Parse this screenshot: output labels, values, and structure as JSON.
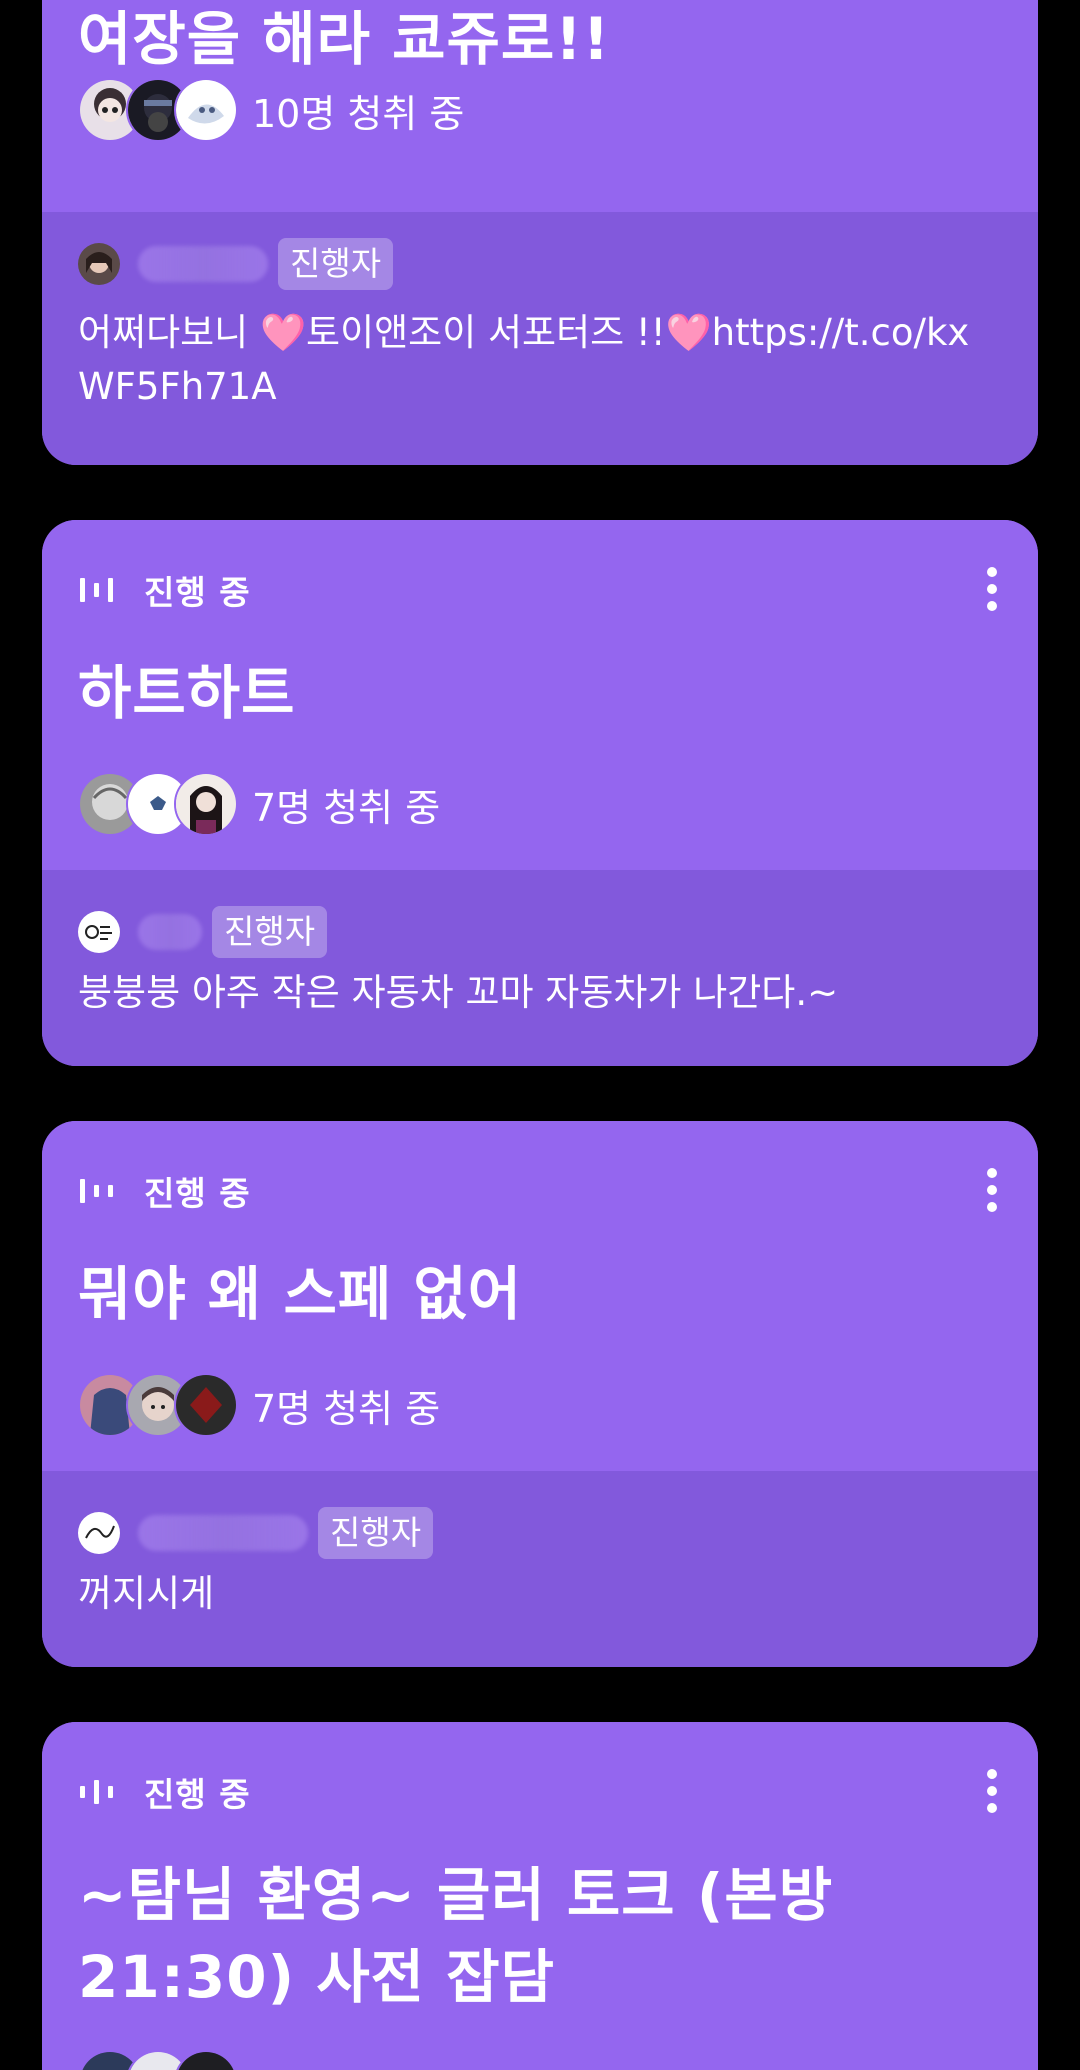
{
  "cards": [
    {
      "title": "여장을 해라 쿄쥬로!!",
      "listeners": "10명 청취 중",
      "host_badge": "진행자",
      "description": "어쩌다보니 🩷토이앤조이 서포터즈 !!🩷https://t.co/kxWF5Fh71A"
    },
    {
      "status": "진행 중",
      "title": "하트하트",
      "listeners": "7명 청취 중",
      "host_badge": "진행자",
      "description": "붕붕붕 아주 작은 자동차 꼬마 자동차가 나간다.~"
    },
    {
      "status": "진행 중",
      "title": "뭐야 왜 스페 없어",
      "listeners": "7명 청취 중",
      "host_badge": "진행자",
      "description": "꺼지시게"
    },
    {
      "status": "진행 중",
      "title": "~탐님 환영~ 글러 토크 (본방 21:30) 사전 잡담"
    }
  ],
  "icons": {
    "live": "live-audio-bars-icon",
    "more": "more-vertical-icon"
  },
  "colors": {
    "background": "#000000",
    "card_top": "#9466ef",
    "card_bottom": "#8259dc"
  }
}
